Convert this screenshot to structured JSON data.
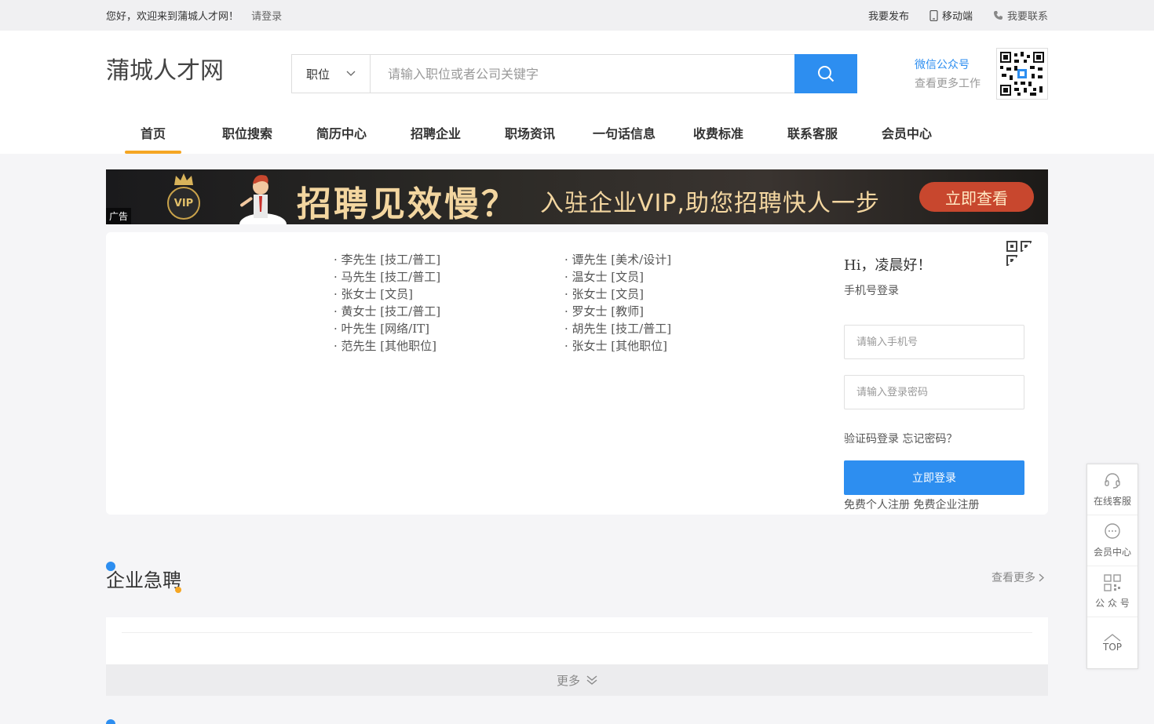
{
  "topbar": {
    "welcome": "您好，欢迎来到蒲城人才网！",
    "login": "请登录",
    "publish": "我要发布",
    "mobile": "移动端",
    "contact": "我要联系"
  },
  "header": {
    "logo": "蒲城人才网",
    "search_type": "职位",
    "search_placeholder": "请输入职位或者公司关键字",
    "wechat_title": "微信公众号",
    "wechat_sub": "查看更多工作"
  },
  "nav": [
    "首页",
    "职位搜索",
    "简历中心",
    "招聘企业",
    "职场资讯",
    "一句话信息",
    "收费标准",
    "联系客服",
    "会员中心"
  ],
  "banner": {
    "ad": "广告",
    "vip": "VIP",
    "headline": "招聘见效慢？",
    "subline": "入驻企业VIP,助您招聘快人一步",
    "cta": "立即查看"
  },
  "resumes_col1": [
    "· 李先生 [技工/普工]",
    "· 马先生 [技工/普工]",
    "· 张女士 [文员]",
    "· 黄女士 [技工/普工]",
    "· 叶先生 [网络/IT]",
    "· 范先生 [其他职位]"
  ],
  "resumes_col2": [
    "· 谭先生 [美术/设计]",
    "· 温女士 [文员]",
    "· 张女士 [文员]",
    "· 罗女士 [教师]",
    "· 胡先生 [技工/普工]",
    "· 张女士 [其他职位]"
  ],
  "login": {
    "greeting": "Hi，凌晨好！",
    "mode": "手机号登录",
    "phone_placeholder": "请输入手机号",
    "password_placeholder": "请输入登录密码",
    "code_login": "验证码登录",
    "forgot": "忘记密码？",
    "submit": "立即登录",
    "reg_personal": "免费个人注册",
    "reg_company": "免费企业注册"
  },
  "section": {
    "title": "企业急聘",
    "more": "查看更多",
    "load_more": "更多"
  },
  "sidebar": [
    "在线客服",
    "会员中心",
    "公 众 号",
    "TOP"
  ],
  "colors": {
    "accent": "#2d8ef0",
    "highlight": "#f5a623"
  }
}
